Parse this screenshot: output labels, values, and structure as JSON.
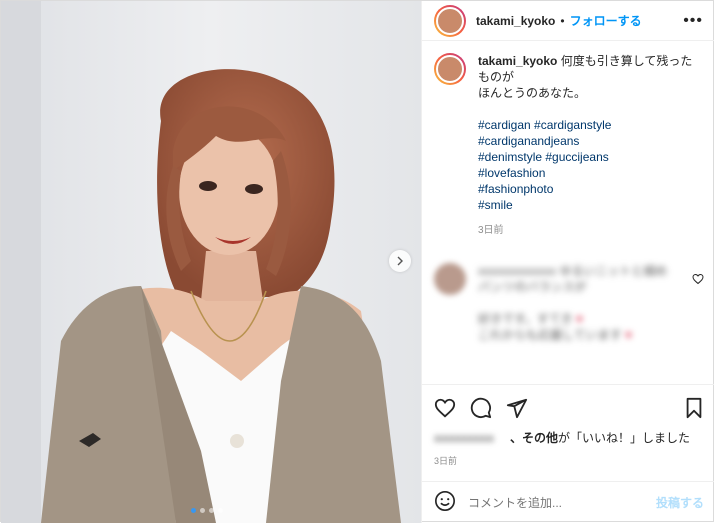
{
  "post": {
    "username": "takami_kyoko",
    "separator": "•",
    "follow_label": "フォローする",
    "more_label": "•••",
    "caption_line1": "何度も引き算して残ったものが",
    "caption_line2": "ほんとうのあなた。",
    "hashtags": [
      "#cardigan #cardiganstyle",
      "#cardiganandjeans",
      "#denimstyle #guccijeans",
      "#lovefashion",
      "#fashionphoto",
      "#smile"
    ],
    "caption_time": "3日前"
  },
  "comment": {
    "user_blurred": "xxxxxxxxxxxxx",
    "text_blurred_1": "ゆるいニットと細めパンツのバランスが",
    "text_blurred_2": "好きです。すてき",
    "text_blurred_3": "これからも応援しています"
  },
  "likes": {
    "blurred_name": "xxxxxxxxxx",
    "suffix_bold": "、その他",
    "suffix_rest": "が「いいね！」しました"
  },
  "footer": {
    "time": "3日前",
    "comment_placeholder": "コメントを追加...",
    "post_label": "投稿する"
  },
  "carousel": {
    "current": 1,
    "total": 4
  },
  "colors": {
    "accent": "#0095f6",
    "hashtag": "#00376b",
    "muted": "#8e8e8e",
    "post_disabled": "#b2dffc"
  }
}
